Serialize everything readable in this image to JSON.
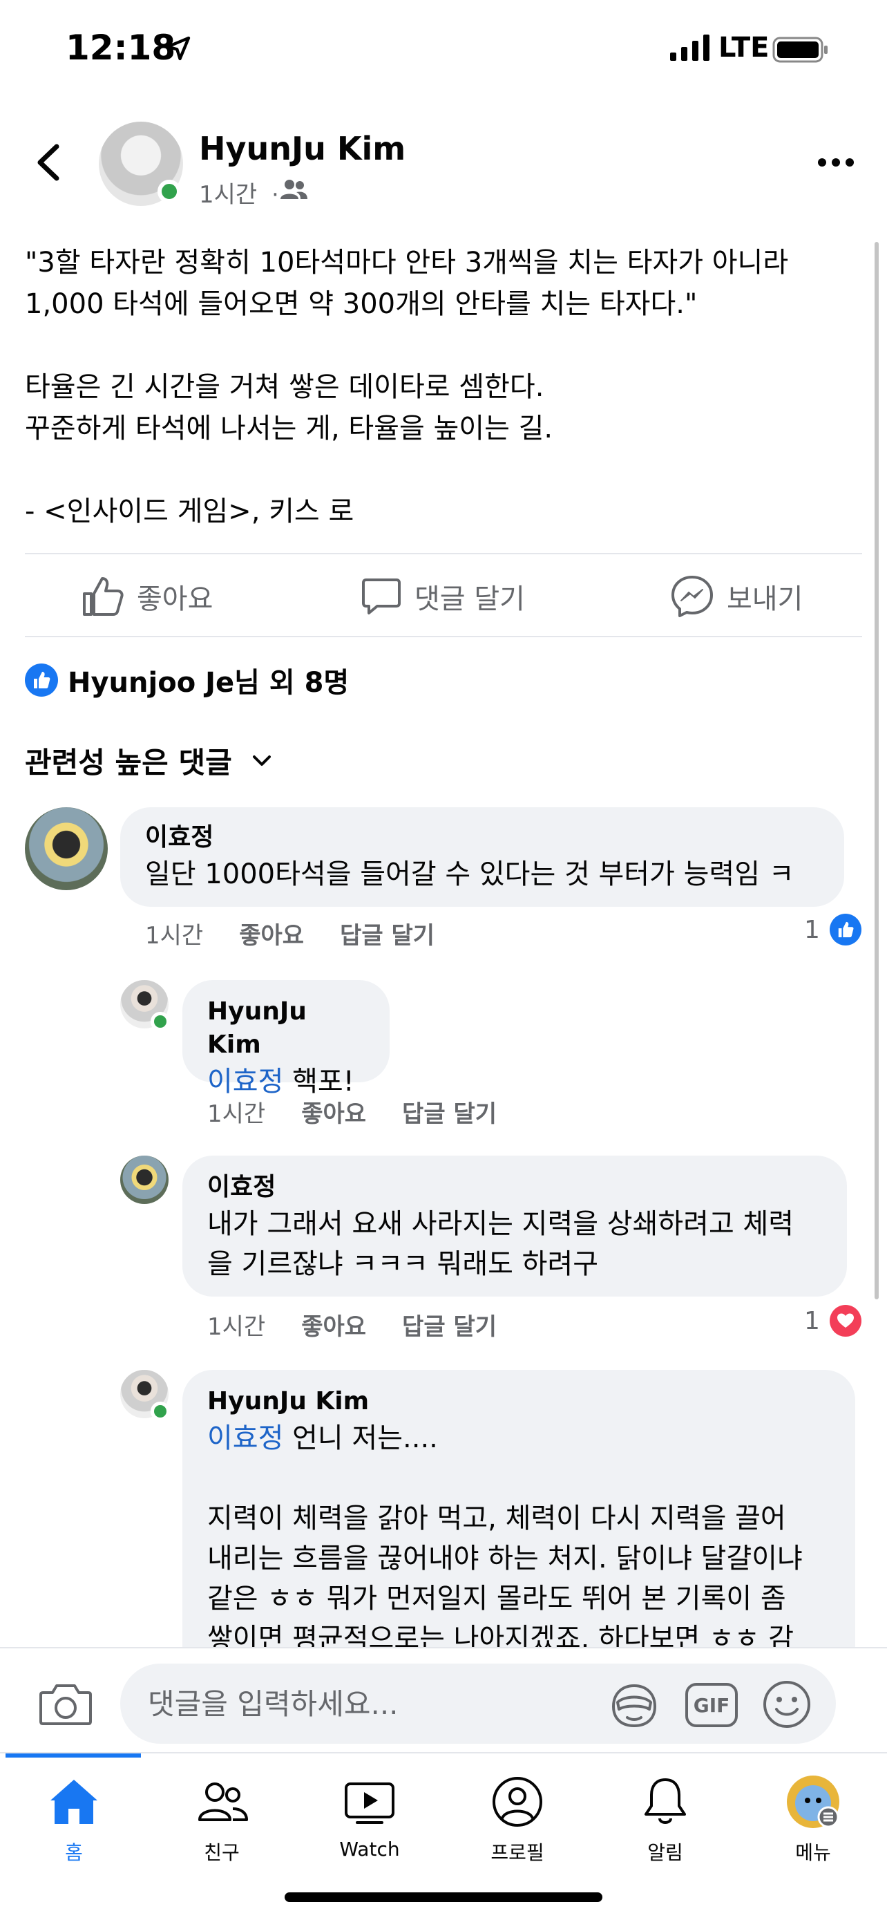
{
  "status_bar": {
    "time": "12:18",
    "network": "LTE"
  },
  "post": {
    "author": "HyunJu Kim",
    "time": "1시간",
    "separator": "·",
    "body": "\"3할 타자란 정확히 10타석마다 안타 3개씩을 치는 타자가 아니라\n1,000 타석에 들어오면 약 300개의 안타를 치는 타자다.\"\n\n타율은 긴 시간을 거쳐 쌓은 데이타로 셈한다.\n꾸준하게 타석에 나서는 게, 타율을 높이는 길.\n\n- <인사이드 게임>, 키스 로"
  },
  "actions": {
    "like": "좋아요",
    "comment": "댓글 달기",
    "send": "보내기"
  },
  "reactions": {
    "summary": "Hyunjoo Je님 외 8명"
  },
  "comments_sort": {
    "label": "관련성 높은 댓글"
  },
  "comments": [
    {
      "name": "이효정",
      "text": "일단 1000타석을 들어갈 수 있다는 것 부터가 능력임 ㅋ",
      "time": "1시간",
      "like": "좋아요",
      "reply": "답글 달기",
      "reaction_count": "1",
      "reaction": "like"
    },
    {
      "name": "HyunJu Kim",
      "mention": "이효정",
      "text": " 핵포!",
      "time": "1시간",
      "like": "좋아요",
      "reply": "답글 달기"
    },
    {
      "name": "이효정",
      "text": "내가 그래서 요새 사라지는 지력을 상쇄하려고 체력\n을 기르잖냐 ㅋㅋㅋ 뭐래도 하려구",
      "time": "1시간",
      "like": "좋아요",
      "reply": "답글 달기",
      "reaction_count": "1",
      "reaction": "love"
    },
    {
      "name": "HyunJu Kim",
      "mention": "이효정",
      "text": " 언니 저는....\n\n지력이 체력을 갉아 먹고, 체력이 다시 지력을 끌어\n내리는 흐름을 끊어내야 하는 처지. 닭이냐 달걀이냐\n같은 ㅎㅎ 뭐가 먼저일지 몰라도 뛰어 본 기록이 좀\n쌓이면 평균적으로는 나아지겠죠. 하다보면 ㅎㅎ 감"
    }
  ],
  "composer": {
    "placeholder": "댓글을 입력하세요...",
    "gif_label": "GIF"
  },
  "tabs": [
    {
      "label": "홈",
      "active": true
    },
    {
      "label": "친구"
    },
    {
      "label": "Watch"
    },
    {
      "label": "프로필"
    },
    {
      "label": "알림"
    },
    {
      "label": "메뉴"
    }
  ],
  "colors": {
    "accent": "#1877f2",
    "online": "#31a24c",
    "love": "#f33e58",
    "mention": "#1d64c8",
    "bubble": "#f0f2f5"
  }
}
